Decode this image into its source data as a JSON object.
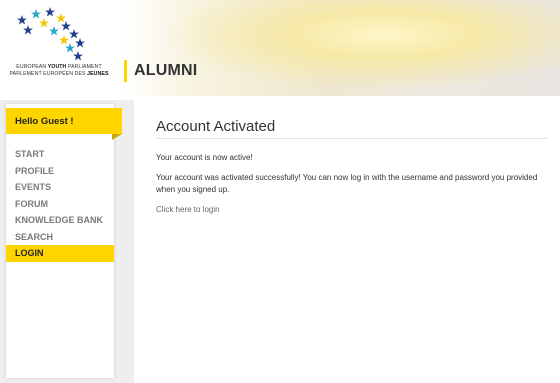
{
  "logo": {
    "line1_prefix": "EUROPEAN ",
    "line1_bold": "YOUTH",
    "line1_suffix": " PARLIAMENT",
    "line2_prefix": "PARLEMENT EUROPÉEN DES ",
    "line2_bold": "JEUNES"
  },
  "header": {
    "section_title": "ALUMNI"
  },
  "sidebar": {
    "greeting": "Hello Guest !",
    "items": [
      {
        "label": "START"
      },
      {
        "label": "PROFILE"
      },
      {
        "label": "EVENTS"
      },
      {
        "label": "FORUM"
      },
      {
        "label": "KNOWLEDGE BANK"
      },
      {
        "label": "SEARCH"
      },
      {
        "label": "LOGIN"
      }
    ],
    "active_item": "LOGIN"
  },
  "main": {
    "title": "Account Activated",
    "status_text": "Your account is now active!",
    "message": "Your account was activated successfully! You can now log in with the username and password you provided when you signed up.",
    "login_link": "Click here to login"
  },
  "colors": {
    "accent": "#ffd500",
    "nav_text": "#7a7a7a",
    "star_blue": "#1f3e8c",
    "star_yellow": "#f2c500",
    "star_cyan": "#2aa6c7"
  }
}
